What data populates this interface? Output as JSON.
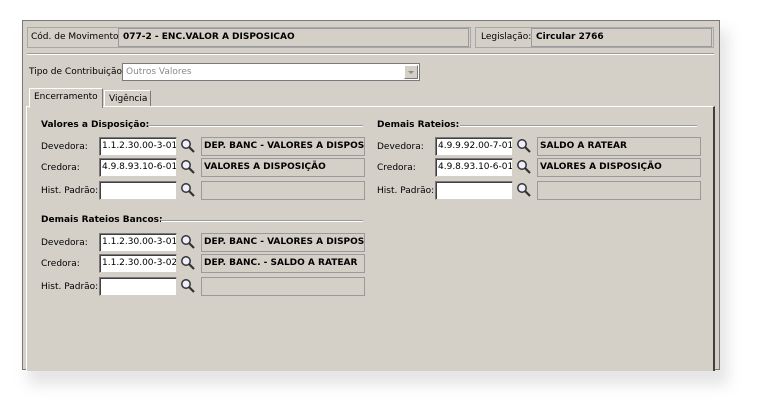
{
  "header": {
    "movimento_label": "Cód. de Movimento:",
    "movimento_value": "077-2 - ENC.VALOR A DISPOSICAO",
    "legislacao_label": "Legislação:",
    "legislacao_value": "Circular 2766"
  },
  "contribuicao": {
    "label": "Tipo de Contribuição:",
    "value": "Outros Valores"
  },
  "tabs": [
    {
      "label": "Encerramento",
      "active": true
    },
    {
      "label": "Vigência",
      "active": false
    }
  ],
  "valores_disposicao": {
    "title": "Valores a Disposição:",
    "devedora_label": "Devedora:",
    "devedora_code": "1.1.2.30.00-3-01",
    "devedora_desc": "DEP. BANC - VALORES A DISPOSIÇÃO",
    "credora_label": "Credora:",
    "credora_code": "4.9.8.93.10-6-01",
    "credora_desc": "VALORES A DISPOSIÇÃO",
    "hist_label": "Hist. Padrão:",
    "hist_code": "",
    "hist_desc": ""
  },
  "demais_rateios": {
    "title": "Demais Rateios:",
    "devedora_label": "Devedora:",
    "devedora_code": "4.9.9.92.00-7-01",
    "devedora_desc": "SALDO A RATEAR",
    "credora_label": "Credora:",
    "credora_code": "4.9.8.93.10-6-01",
    "credora_desc": "VALORES A DISPOSIÇÃO",
    "hist_label": "Hist. Padrão:",
    "hist_code": "",
    "hist_desc": ""
  },
  "demais_rateios_bancos": {
    "title": "Demais Rateios Bancos:",
    "devedora_label": "Devedora:",
    "devedora_code": "1.1.2.30.00-3-01",
    "devedora_desc": "DEP. BANC - VALORES A DISPOSIÇÃO",
    "credora_label": "Credora:",
    "credora_code": "1.1.2.30.00-3-02",
    "credora_desc": "DEP. BANC. - SALDO A RATEAR",
    "hist_label": "Hist. Padrão:",
    "hist_code": "",
    "hist_desc": ""
  },
  "icons": {
    "lookup": "magnifier-icon",
    "dropdown": "chevron-down-icon"
  }
}
